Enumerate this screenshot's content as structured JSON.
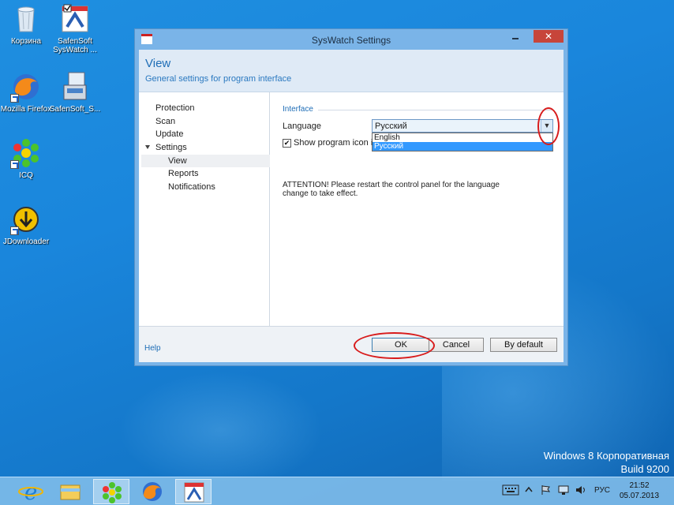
{
  "desktop": {
    "icons": [
      {
        "label": "Корзина",
        "icon": "recycle-bin-icon"
      },
      {
        "label": "SafenSoft SysWatch ...",
        "icon": "syswatch-icon"
      },
      {
        "label": "Mozilla Firefox",
        "icon": "firefox-icon"
      },
      {
        "label": "SafenSoft_S...",
        "icon": "installer-icon"
      },
      {
        "label": "ICQ",
        "icon": "icq-icon"
      },
      {
        "label": "JDownloader",
        "icon": "jdownloader-icon"
      }
    ],
    "watermark_line1": "Windows 8 Корпоративная",
    "watermark_line2": "Build 9200"
  },
  "window": {
    "title": "SysWatch Settings",
    "close_glyph": "✕",
    "header_title": "View",
    "header_subtitle": "General settings for program interface",
    "nav": [
      "Protection",
      "Scan",
      "Update",
      "Settings",
      "View",
      "Reports",
      "Notifications"
    ],
    "selected_nav": "View",
    "group_label": "Interface",
    "language_label": "Language",
    "language_value": "Русский",
    "language_options": [
      "English",
      "Русский"
    ],
    "highlighted_option": "Русский",
    "checkbox_label": "Show program icon in",
    "checkbox_checked": true,
    "attention_text": "ATTENTION! Please restart the control panel for the language change to take effect.",
    "help_label": "Help",
    "ok_label": "OK",
    "cancel_label": "Cancel",
    "default_label": "By default"
  },
  "taskbar": {
    "apps": [
      "ie-icon",
      "explorer-icon",
      "icq-icon",
      "firefox-icon",
      "syswatch-icon"
    ],
    "active_app": "syswatch-icon",
    "lang": "РУС",
    "time": "21:52",
    "date": "05.07.2013"
  },
  "colors": {
    "annotation": "#d81c1c",
    "accent": "#1e6db6",
    "highlight": "#3399ff"
  }
}
